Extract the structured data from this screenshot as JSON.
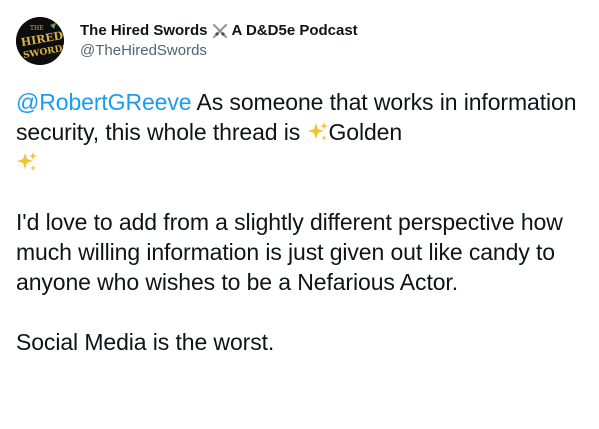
{
  "author": {
    "display_name_part1": "The Hired Swords",
    "display_name_part2": "A D&D5e Podcast",
    "handle": "@TheHiredSwords",
    "avatar_text_top": "THE",
    "avatar_text_mid": "HIRED",
    "avatar_text_bottom": "SWORDS"
  },
  "tweet": {
    "mention": "@RobertGReeve",
    "line1_rest": " As someone that works in information security, this whole thread is ",
    "golden_word": "Golden",
    "paragraph2": "I'd love to add from a slightly different perspective how much willing information is just given out like candy to anyone who wishes to be a Nefarious Actor.",
    "paragraph3": "Social Media is the worst."
  },
  "icons": {
    "avatar": "podcast-logo-icon",
    "swords": "crossed-swords-icon",
    "sparkles": "sparkles-icon"
  },
  "colors": {
    "mention": "#1d9bf0",
    "handle": "#536471",
    "text": "#0f1419",
    "sparkle": "#f4c430"
  }
}
